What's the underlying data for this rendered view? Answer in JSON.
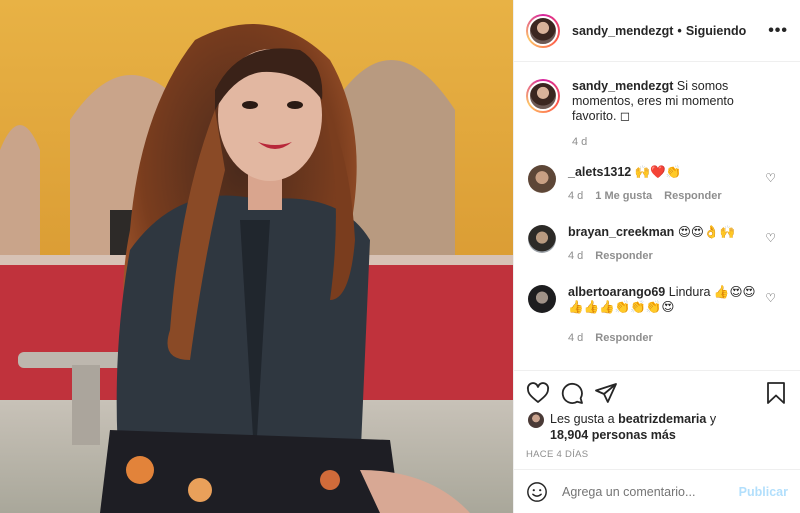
{
  "post": {
    "username": "sandy_mendezgt",
    "follow_status": "Siguiendo",
    "more_label": "•••"
  },
  "caption": {
    "username": "sandy_mendezgt",
    "text": "Si somos momentos, eres mi momento favorito. ◻",
    "time": "4 d"
  },
  "comments": [
    {
      "username": "_alets1312",
      "text": "🙌❤️👏",
      "time": "4 d",
      "likes": "1 Me gusta",
      "reply": "Responder"
    },
    {
      "username": "brayan_creekman",
      "text": "😍😍👌🙌",
      "time": "4 d",
      "reply": "Responder"
    },
    {
      "username": "albertoarango69",
      "text": "Lindura 👍😍😍👍👍👍👏👏👏😍",
      "time": "4 d",
      "reply": "Responder"
    }
  ],
  "likes": {
    "prefix": "Les gusta a",
    "user": "beatrizdemaria",
    "join": "y",
    "others": "18,904 personas más"
  },
  "timestamp": "HACE 4 DÍAS",
  "add_comment": {
    "placeholder": "Agrega un comentario...",
    "post_label": "Publicar"
  },
  "icons": {
    "like": "heart-icon",
    "comment": "comment-icon",
    "share": "share-icon",
    "save": "bookmark-icon",
    "emoji": "emoji-icon"
  },
  "colors": {
    "text": "#262626",
    "muted": "#8e8e8e",
    "post_disabled": "#b2dffc",
    "border": "#efefef"
  }
}
